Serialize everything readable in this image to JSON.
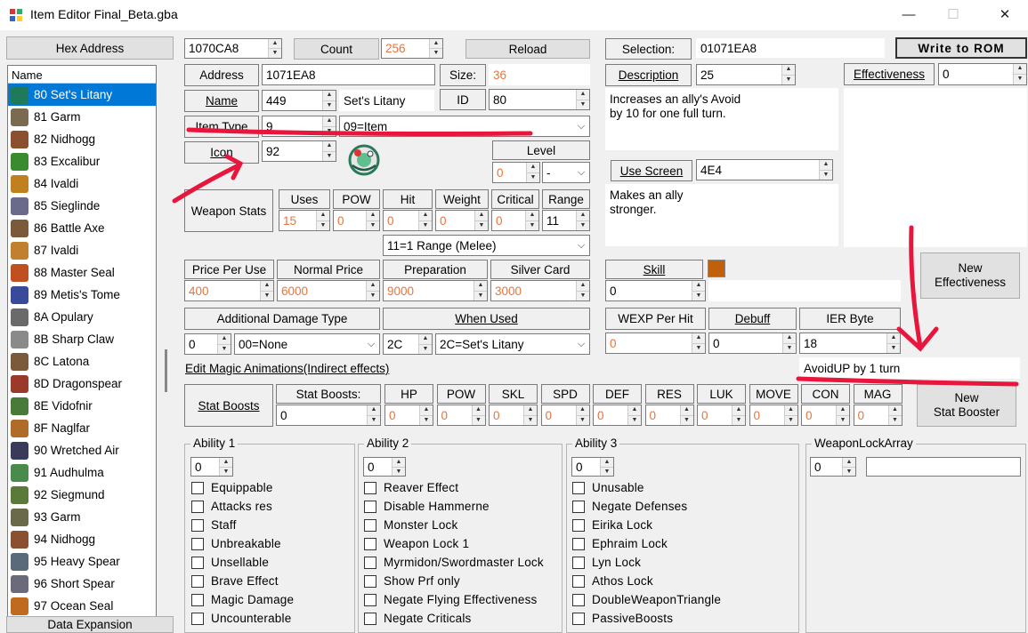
{
  "window": {
    "title": "Item Editor Final_Beta.gba",
    "minimize": "—",
    "maximize": "☐",
    "close": "✕"
  },
  "left": {
    "hex_address_btn": "Hex Address",
    "name_header": "Name",
    "data_expansion_btn": "Data Expansion",
    "items": [
      "80 Set's Litany",
      "81 Garm",
      "82 Nidhogg",
      "83 Excalibur",
      "84 Ivaldi",
      "85 Sieglinde",
      "86 Battle Axe",
      "87 Ivaldi",
      "88 Master Seal",
      "89 Metis's Tome",
      "8A Opulary",
      "8B Sharp Claw",
      "8C Latona",
      "8D Dragonspear",
      "8E Vidofnir",
      "8F Naglfar",
      "90 Wretched Air",
      "91 Audhulma",
      "92 Siegmund",
      "93 Garm",
      "94 Nidhogg",
      "95 Heavy Spear",
      "96 Short Spear",
      "97 Ocean Seal"
    ]
  },
  "top": {
    "hex_value": "1070CA8",
    "count_btn": "Count",
    "count_value": "256",
    "reload_btn": "Reload",
    "selection_lbl": "Selection:",
    "selection_value": "01071EA8",
    "write_btn": "Write to ROM"
  },
  "row2": {
    "address_lbl": "Address",
    "address_value": "1071EA8",
    "size_lbl": "Size:",
    "size_value": "36",
    "desc_lbl": "Description",
    "desc_value": "25",
    "eff_lbl": "Effectiveness",
    "eff_value": "0"
  },
  "row3": {
    "name_lbl": "Name",
    "name_value": "449",
    "name_text": "Set's Litany",
    "id_lbl": "ID",
    "id_value": "80"
  },
  "row4": {
    "itemtype_lbl": "Item Type",
    "itemtype_value": "9",
    "itemtype_combo": "09=Item"
  },
  "row5": {
    "icon_lbl": "Icon",
    "icon_value": "92",
    "level_lbl": "Level",
    "level_value": "0",
    "level_combo": "-"
  },
  "desc_text1": "Increases an ally's Avoid",
  "desc_text2": "by 10 for one full turn.",
  "usescreen_lbl": "Use Screen",
  "usescreen_value": "4E4",
  "use_text1": "Makes an ally",
  "use_text2": "stronger.",
  "weapon": {
    "stats_btn": "Weapon Stats",
    "uses_lbl": "Uses",
    "pow_lbl": "POW",
    "hit_lbl": "Hit",
    "weight_lbl": "Weight",
    "crit_lbl": "Critical",
    "range_lbl": "Range",
    "uses": "15",
    "pow": "0",
    "hit": "0",
    "weight": "0",
    "crit": "0",
    "range": "11",
    "range_combo": "11=1 Range (Melee)"
  },
  "price": {
    "ppu_lbl": "Price Per Use",
    "normal_lbl": "Normal Price",
    "prep_lbl": "Preparation",
    "silver_lbl": "Silver Card",
    "ppu": "400",
    "normal": "6000",
    "prep": "9000",
    "silver": "3000"
  },
  "skill": {
    "lbl": "Skill",
    "value": "0"
  },
  "new_eff_btn1": "New",
  "new_eff_btn2": "Effectiveness",
  "dmg": {
    "lbl": "Additional Damage Type",
    "value": "0",
    "combo": "00=None",
    "when_lbl": "When Used",
    "when_value": "2C",
    "when_combo": "2C=Set's Litany"
  },
  "wexp": {
    "lbl": "WEXP Per Hit",
    "value": "0",
    "debuff_lbl": "Debuff",
    "debuff_value": "0",
    "ier_lbl": "IER Byte",
    "ier_value": "18"
  },
  "magic_anim_link": "Edit Magic Animations(Indirect effects)",
  "ier_text": "AvoidUP by 1 turn",
  "stat": {
    "btn": "Stat Boosts",
    "lbl": "Stat Boosts:",
    "value": "0",
    "hp": "HP",
    "pow": "POW",
    "skl": "SKL",
    "spd": "SPD",
    "def": "DEF",
    "res": "RES",
    "luk": "LUK",
    "move": "MOVE",
    "con": "CON",
    "mag": "MAG",
    "zero": "0",
    "new1": "New",
    "new2": "Stat Booster"
  },
  "ab1": {
    "cap": "Ability 1",
    "value": "0",
    "items": [
      "Equippable",
      "Attacks res",
      "Staff",
      "Unbreakable",
      "Unsellable",
      "Brave Effect",
      "Magic Damage",
      "Uncounterable"
    ]
  },
  "ab2": {
    "cap": "Ability 2",
    "value": "0",
    "items": [
      "Reaver Effect",
      "Disable Hammerne",
      "Monster Lock",
      "Weapon Lock 1",
      "Myrmidon/Swordmaster Lock",
      "Show Prf only",
      "Negate Flying Effectiveness",
      "Negate Criticals"
    ]
  },
  "ab3": {
    "cap": "Ability 3",
    "value": "0",
    "items": [
      "Unusable",
      "Negate Defenses",
      "Eirika Lock",
      "Ephraim Lock",
      "Lyn Lock",
      "Athos Lock",
      "DoubleWeaponTriangle",
      "PassiveBoosts"
    ]
  },
  "wla": {
    "cap": "WeaponLockArray",
    "value": "0"
  },
  "colors": {
    "accent": "#0078d7",
    "orange": "#e8743b",
    "annotation": "#e8163c",
    "skill_swatch": "#c0600a"
  }
}
